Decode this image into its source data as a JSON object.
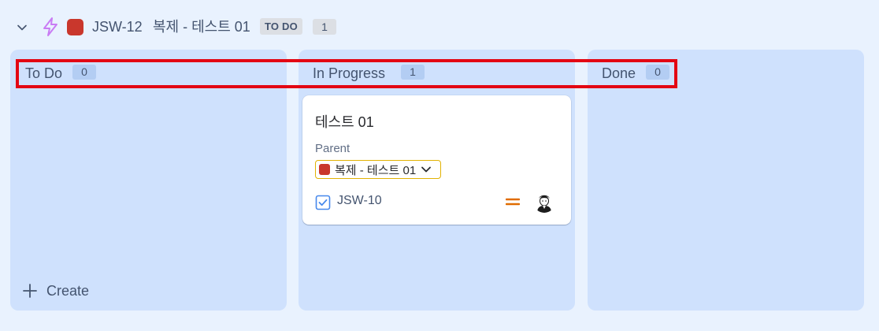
{
  "swimlane": {
    "expand_icon": "chevron-down-icon",
    "type_icon": "lightning-bolt-icon",
    "epic_color": "#c9372c",
    "key": "JSW-12",
    "title": "복제 - 테스트 01",
    "status": "TO DO",
    "issue_count": "1"
  },
  "columns": [
    {
      "title": "To Do",
      "count": "0"
    },
    {
      "title": "In Progress",
      "count": "1"
    },
    {
      "title": "Done",
      "count": "0"
    }
  ],
  "create": {
    "label": "Create",
    "icon": "plus-icon"
  },
  "card": {
    "title": "테스트 01",
    "parent_label": "Parent",
    "parent_value": "복제 - 테스트 01",
    "parent_color": "#c9372c",
    "type_icon": "checkbox-task-icon",
    "key": "JSW-10",
    "priority_icon": "priority-medium-icon",
    "assignee_icon": "avatar"
  },
  "colors": {
    "background": "#e9f2fe",
    "column": "#cfe1fd",
    "highlight": "#e30613",
    "priority": "#e06c00"
  }
}
